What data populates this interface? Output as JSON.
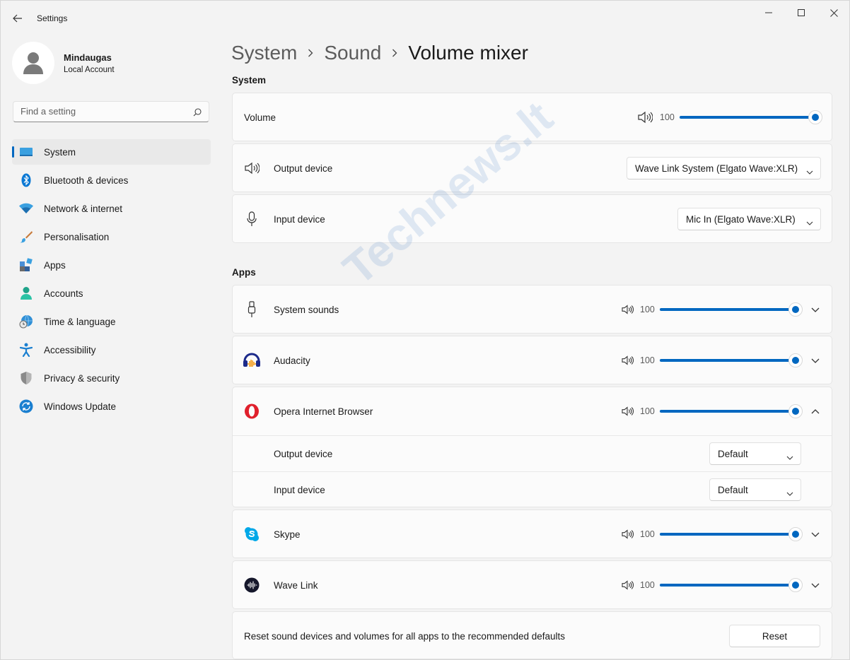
{
  "window": {
    "title": "Settings"
  },
  "profile": {
    "name": "Mindaugas",
    "account": "Local Account"
  },
  "search": {
    "placeholder": "Find a setting"
  },
  "sidebar": {
    "items": [
      {
        "label": "System",
        "icon": "system-icon",
        "active": true
      },
      {
        "label": "Bluetooth & devices",
        "icon": "bluetooth-icon"
      },
      {
        "label": "Network & internet",
        "icon": "wifi-icon"
      },
      {
        "label": "Personalisation",
        "icon": "brush-icon"
      },
      {
        "label": "Apps",
        "icon": "apps-icon"
      },
      {
        "label": "Accounts",
        "icon": "person-icon"
      },
      {
        "label": "Time & language",
        "icon": "globe-clock-icon"
      },
      {
        "label": "Accessibility",
        "icon": "accessibility-icon"
      },
      {
        "label": "Privacy & security",
        "icon": "shield-icon"
      },
      {
        "label": "Windows Update",
        "icon": "update-icon"
      }
    ]
  },
  "breadcrumb": [
    "System",
    "Sound",
    "Volume mixer"
  ],
  "system_section": {
    "heading": "System",
    "volume": {
      "label": "Volume",
      "value": "100",
      "level": 1.0
    },
    "output": {
      "label": "Output device",
      "selected": "Wave Link System (Elgato Wave:XLR)"
    },
    "input": {
      "label": "Input device",
      "selected": "Mic In (Elgato Wave:XLR)"
    }
  },
  "apps_section": {
    "heading": "Apps",
    "apps": [
      {
        "name": "System sounds",
        "icon": "system-sounds-icon",
        "volume": "100",
        "level": 1.0,
        "expanded": false
      },
      {
        "name": "Audacity",
        "icon": "audacity-icon",
        "volume": "100",
        "level": 1.0,
        "expanded": false
      },
      {
        "name": "Opera Internet Browser",
        "icon": "opera-icon",
        "volume": "100",
        "level": 1.0,
        "expanded": true,
        "output_label": "Output device",
        "output_value": "Default",
        "input_label": "Input device",
        "input_value": "Default"
      },
      {
        "name": "Skype",
        "icon": "skype-icon",
        "volume": "100",
        "level": 1.0,
        "expanded": false
      },
      {
        "name": "Wave Link",
        "icon": "wave-link-icon",
        "volume": "100",
        "level": 1.0,
        "expanded": false
      }
    ]
  },
  "reset": {
    "text": "Reset sound devices and volumes for all apps to the recommended defaults",
    "button": "Reset"
  },
  "watermark": "Technews.lt",
  "colors": {
    "accent": "#0067c0",
    "background": "#f3f3f3",
    "card": "#fbfbfb"
  }
}
